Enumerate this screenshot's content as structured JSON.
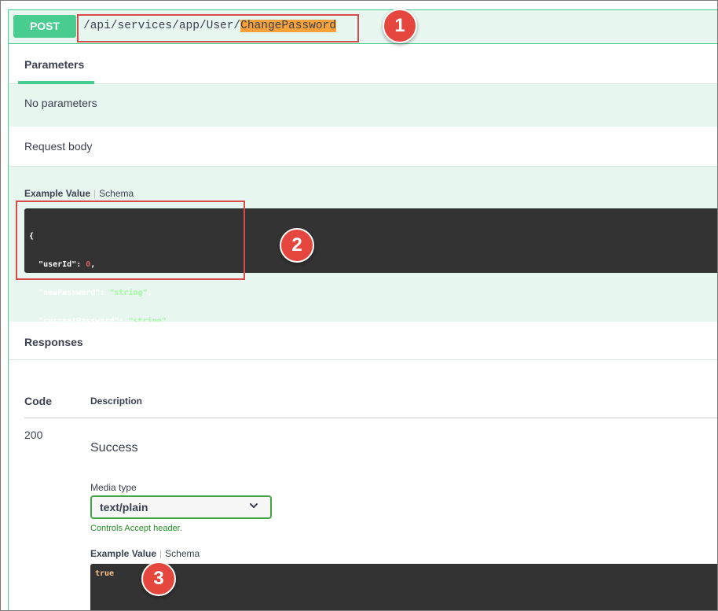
{
  "operation": {
    "method": "POST",
    "path_prefix": "/api/services/app/User/",
    "path_highlight": "ChangePassword"
  },
  "parameters": {
    "tab_label": "Parameters",
    "empty_text": "No parameters"
  },
  "request_body": {
    "label": "Request body",
    "example_tab": "Example Value",
    "schema_tab": "Schema",
    "example": {
      "open_brace": "{",
      "close_brace": "}",
      "fields": [
        {
          "key": "\"userId\"",
          "value": "0",
          "type": "number"
        },
        {
          "key": "\"newPassword\"",
          "value": "\"string\"",
          "type": "string"
        },
        {
          "key": "\"currentPassword\"",
          "value": "\"string\"",
          "type": "string"
        }
      ]
    }
  },
  "responses": {
    "title": "Responses",
    "col_code": "Code",
    "col_description": "Description",
    "items": [
      {
        "code": "200",
        "description": "Success",
        "media_type_label": "Media type",
        "media_type_value": "text/plain",
        "controls_note": "Controls Accept header.",
        "example_tab": "Example Value",
        "schema_tab": "Schema",
        "example_value": "true"
      }
    ]
  },
  "annotations": [
    "1",
    "2",
    "3"
  ],
  "colors": {
    "post_green": "#49cc90",
    "highlight_orange": "#f7a13a",
    "annotation_red": "#e5473e",
    "code_bg": "#333333"
  }
}
